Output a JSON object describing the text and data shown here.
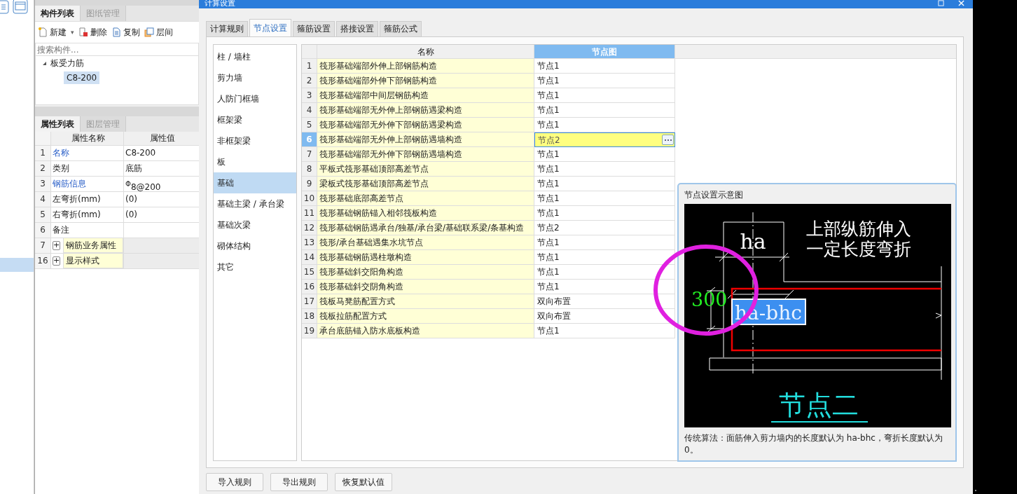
{
  "component_panel": {
    "tabs": [
      {
        "label": "构件列表",
        "selected": true
      },
      {
        "label": "图纸管理",
        "selected": false
      }
    ],
    "toolbar": [
      {
        "label": "新建",
        "caret": "▾"
      },
      {
        "label": "删除"
      },
      {
        "label": "复制"
      },
      {
        "label": "层间"
      }
    ],
    "search": {
      "placeholder": "搜索构件..."
    },
    "tree": [
      {
        "label": "板受力筋",
        "expanded": true,
        "children": [
          {
            "label": "C8-200",
            "selected": true
          }
        ]
      }
    ]
  },
  "property_panel": {
    "tabs": [
      {
        "label": "属性列表",
        "selected": true
      },
      {
        "label": "图层管理",
        "selected": false
      }
    ],
    "columns": [
      "属性名称",
      "属性值"
    ],
    "rows": [
      {
        "index": "1",
        "name": "名称",
        "value": "C8-200",
        "kind": "link"
      },
      {
        "index": "2",
        "name": "类别",
        "value": "底筋",
        "kind": "plain"
      },
      {
        "index": "3",
        "name": "钢筋信息",
        "value": "$^{Φ}$8@200",
        "kind": "link"
      },
      {
        "index": "4",
        "name": "左弯折(mm)",
        "value": "(0)",
        "kind": "plain"
      },
      {
        "index": "5",
        "name": "右弯折(mm)",
        "value": "(0)",
        "kind": "plain"
      },
      {
        "index": "6",
        "name": "备注",
        "value": "",
        "kind": "plain"
      },
      {
        "index": "7",
        "name": "钢筋业务属性",
        "kind": "group",
        "toggle": "+"
      },
      {
        "index": "16",
        "name": "显示样式",
        "kind": "group",
        "toggle": "+"
      }
    ]
  },
  "dialog": {
    "title": "计算设置",
    "tabs": [
      {
        "label": "计算规则",
        "selected": false
      },
      {
        "label": "节点设置",
        "selected": true
      },
      {
        "label": "箍筋设置",
        "selected": false
      },
      {
        "label": "搭接设置",
        "selected": false
      },
      {
        "label": "箍筋公式",
        "selected": false
      }
    ],
    "categories": [
      {
        "label": "柱 / 墙柱",
        "selected": false
      },
      {
        "label": "剪力墙",
        "selected": false
      },
      {
        "label": "人防门框墙",
        "selected": false
      },
      {
        "label": "框架梁",
        "selected": false
      },
      {
        "label": "非框架梁",
        "selected": false
      },
      {
        "label": "板",
        "selected": false
      },
      {
        "label": "基础",
        "selected": true
      },
      {
        "label": "基础主梁 / 承台梁",
        "selected": false
      },
      {
        "label": "基础次梁",
        "selected": false
      },
      {
        "label": "砌体结构",
        "selected": false
      },
      {
        "label": "其它",
        "selected": false
      }
    ],
    "grid": {
      "columns": [
        {
          "label": "名称",
          "selected": false
        },
        {
          "label": "节点图",
          "selected": true
        }
      ],
      "rows": [
        {
          "index": "1",
          "name": "筏形基础端部外伸上部钢筋构造",
          "value": "节点1",
          "selected": false
        },
        {
          "index": "2",
          "name": "筏形基础端部外伸下部钢筋构造",
          "value": "节点1",
          "selected": false
        },
        {
          "index": "3",
          "name": "筏形基础端部中间层钢筋构造",
          "value": "节点1",
          "selected": false
        },
        {
          "index": "4",
          "name": "筏形基础端部无外伸上部钢筋遇梁构造",
          "value": "节点1",
          "selected": false
        },
        {
          "index": "5",
          "name": "筏形基础端部无外伸下部钢筋遇梁构造",
          "value": "节点1",
          "selected": false
        },
        {
          "index": "6",
          "name": "筏形基础端部无外伸上部钢筋遇墙构造",
          "value": "节点2",
          "selected": true
        },
        {
          "index": "7",
          "name": "筏形基础端部无外伸下部钢筋遇墙构造",
          "value": "节点1",
          "selected": false
        },
        {
          "index": "8",
          "name": "平板式筏形基础顶部高差节点",
          "value": "节点1",
          "selected": false
        },
        {
          "index": "9",
          "name": "梁板式筏形基础顶部高差节点",
          "value": "节点1",
          "selected": false
        },
        {
          "index": "10",
          "name": "筏形基础底部高差节点",
          "value": "节点1",
          "selected": false
        },
        {
          "index": "11",
          "name": "筏形基础钢筋锚入相邻筏板构造",
          "value": "节点1",
          "selected": false
        },
        {
          "index": "12",
          "name": "筏形基础钢筋遇承台/独基/承台梁/基础联系梁/条基构造",
          "value": "节点2",
          "selected": false
        },
        {
          "index": "13",
          "name": "筏形/承台基础遇集水坑节点",
          "value": "节点1",
          "selected": false
        },
        {
          "index": "14",
          "name": "筏形基础钢筋遇柱墩构造",
          "value": "节点1",
          "selected": false
        },
        {
          "index": "15",
          "name": "筏形基础斜交阳角构造",
          "value": "节点1",
          "selected": false
        },
        {
          "index": "16",
          "name": "筏形基础斜交阴角构造",
          "value": "节点1",
          "selected": false
        },
        {
          "index": "17",
          "name": "筏板马凳筋配置方式",
          "value": "双向布置",
          "selected": false
        },
        {
          "index": "18",
          "name": "筏板拉筋配置方式",
          "value": "双向布置",
          "selected": false
        },
        {
          "index": "19",
          "name": "承台底筋锚入防水底板构造",
          "value": "节点1",
          "selected": false
        }
      ]
    },
    "preview": {
      "title": "节点设置示意图",
      "drawing": {
        "top_dimension": "ha",
        "note_lines": [
          "上部纵筋伸入",
          "一定长度弯折"
        ],
        "side_dimension": "300",
        "selected_label": "ha-bhc",
        "node_title": "节点二"
      },
      "caption": "传统算法：面筋伸入剪力墙内的长度默认为 ha-bhc，弯折长度默认为0。"
    },
    "buttons": [
      "导入规则",
      "导出规则",
      "恢复默认值"
    ]
  }
}
